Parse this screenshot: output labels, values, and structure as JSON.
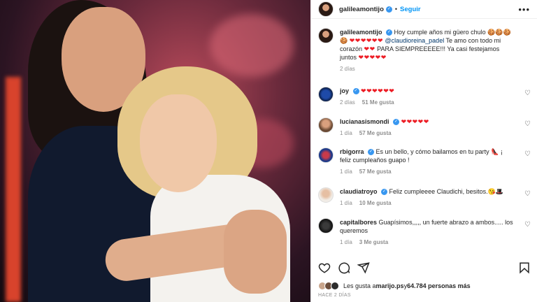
{
  "post": {
    "username": "galileamontijo",
    "follow_label": "Seguir",
    "more_label": "•••",
    "dot": "•"
  },
  "caption": {
    "username": "galileamontijo",
    "text_a": "Hoy cumple años mi güero chulo",
    "emoji_a": "🍪🍪🍪🍪",
    "hearts_a": "❤❤❤❤❤❤",
    "mention": "@claudioreina_padel",
    "text_b": "Te amo con todo mi corazón",
    "hearts_b": "❤❤",
    "text_c": "PARA SIEMPREEEEE!!! Ya casi festejamos juntos",
    "hearts_c": "❤❤❤❤❤",
    "time": "2 días"
  },
  "comments": [
    {
      "username": "joy",
      "text": "",
      "hearts": "❤❤❤❤❤❤",
      "time": "2 días",
      "likes": "51 Me gusta",
      "verified": true
    },
    {
      "username": "lucianasismondi",
      "text": "",
      "hearts": "❤❤❤❤❤",
      "time": "1 día",
      "likes": "57 Me gusta",
      "verified": true
    },
    {
      "username": "rbigorra",
      "text": "Es un bello, y cómo bailamos en tu party 👠 ¡ feliz cumpleaños guapo !",
      "hearts": "",
      "time": "1 día",
      "likes": "57 Me gusta",
      "verified": true
    },
    {
      "username": "claudiatroyo",
      "text": "Feliz cumpleeee Claudichi, besitos.😘🎩",
      "hearts": "",
      "time": "1 día",
      "likes": "10 Me gusta",
      "verified": true
    },
    {
      "username": "capitalbores",
      "text": "Guapísimos,,,,, un fuerte abrazo a ambos..... los queremos",
      "hearts": "",
      "time": "1 día",
      "likes": "3 Me gusta",
      "verified": false
    }
  ],
  "icons": {
    "like": "heart-icon",
    "comment": "comment-icon",
    "share": "share-icon",
    "save": "bookmark-icon",
    "more": "more-icon",
    "verified": "verified-icon"
  },
  "likes_line": {
    "prefix": "Les gusta a ",
    "user": "marijo.ps",
    "middle": " y ",
    "count": "64.784 personas más"
  },
  "date": "HACE 2 DÍAS",
  "colors": {
    "accent": "#0095f6",
    "verified": "#3897f0",
    "heart": "#ed1c24",
    "muted": "#8e8e8e"
  }
}
